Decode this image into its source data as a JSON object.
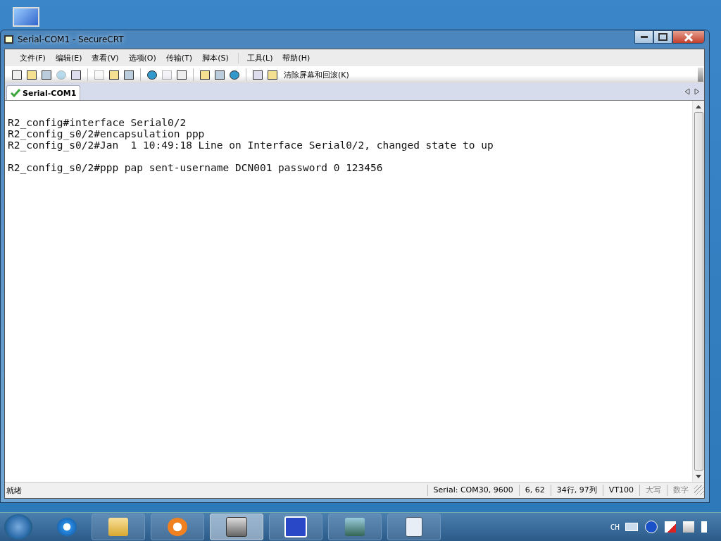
{
  "window": {
    "title": "Serial-COM1 - SecureCRT"
  },
  "menu": [
    {
      "label": "文件(F)",
      "separator_before": false
    },
    {
      "label": "编辑(E)",
      "separator_before": false
    },
    {
      "label": "查看(V)",
      "separator_before": false
    },
    {
      "label": "选项(O)",
      "separator_before": false
    },
    {
      "label": "传输(T)",
      "separator_before": false
    },
    {
      "label": "脚本(S)",
      "separator_before": false
    },
    {
      "label": "工具(L)",
      "separator_before": true
    },
    {
      "label": "帮助(H)",
      "separator_before": false
    }
  ],
  "toolbar": {
    "buttons": [
      {
        "disabled": false
      },
      {
        "disabled": false
      },
      {
        "disabled": false
      },
      {
        "disabled": true
      },
      {
        "disabled": false
      },
      {
        "disabled": true
      },
      {
        "disabled": false
      },
      {
        "disabled": false
      },
      {
        "disabled": false
      },
      {
        "disabled": true
      },
      {
        "disabled": false
      },
      {
        "disabled": false
      },
      {
        "disabled": false
      },
      {
        "disabled": false
      },
      {
        "disabled": false
      }
    ],
    "clear_button": "清除屏幕和回滚(K)"
  },
  "tabs": [
    {
      "label": "Serial-COM1",
      "selected": true,
      "connected": true
    }
  ],
  "terminal": {
    "blocks": [
      {
        "lines": [
          "R2_config#interface Serial0/2",
          "R2_config_s0/2#encapsulation ppp",
          "R2_config_s0/2#Jan  1 10:49:18 Line on Interface Serial0/2, changed state to up"
        ]
      },
      {
        "lines": [
          "R2_config_s0/2#ppp pap sent-username DCN001 password 0 123456"
        ]
      }
    ]
  },
  "status_bar": {
    "message": "就绪",
    "fields": [
      {
        "text": "Serial: COM30, 9600",
        "disabled": false
      },
      {
        "text": "6,  62",
        "disabled": false
      },
      {
        "text": "34行, 97列",
        "disabled": false
      },
      {
        "text": "VT100",
        "disabled": false
      },
      {
        "text": "大写",
        "disabled": true
      },
      {
        "text": "数字",
        "disabled": true
      }
    ]
  },
  "taskbar": {
    "items": [
      {
        "selected": false
      },
      {
        "selected": false
      },
      {
        "selected": false
      },
      {
        "selected": true
      },
      {
        "selected": false
      },
      {
        "selected": false
      },
      {
        "selected": false
      }
    ],
    "tray": {
      "language": "CH"
    }
  }
}
